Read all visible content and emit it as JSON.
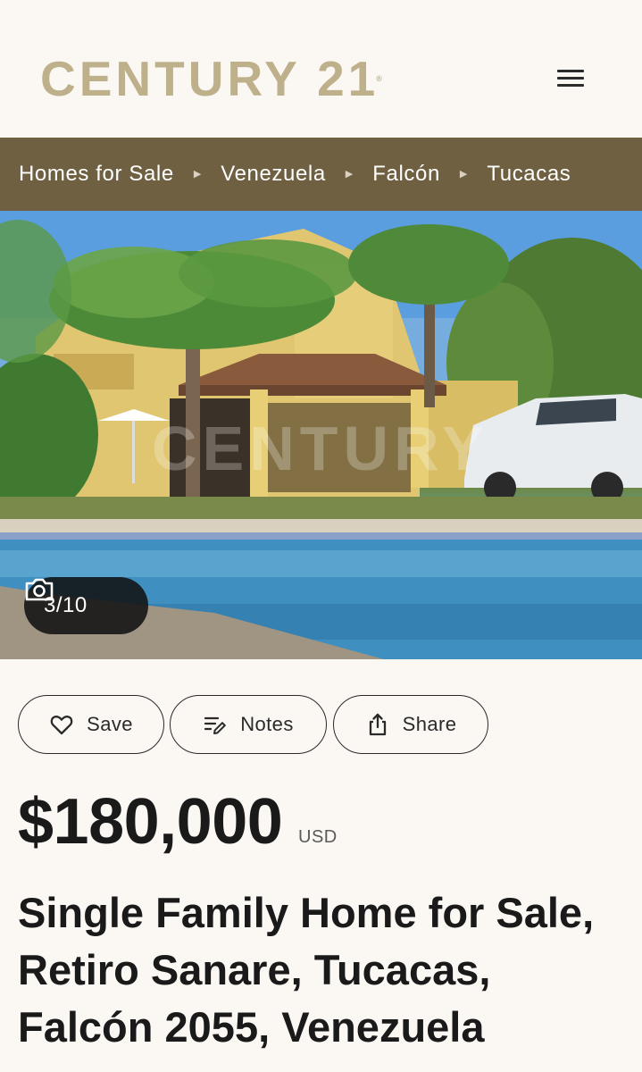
{
  "header": {
    "logo_text": "CENTURY 21",
    "logo_mark": "®",
    "menu_icon": "hamburger-menu-icon"
  },
  "breadcrumb": {
    "items": [
      "Homes for Sale",
      "Venezuela",
      "Falcón",
      "Tucacas"
    ],
    "separator_icon": "triangle-right-icon"
  },
  "gallery": {
    "counter": "3/10",
    "counter_icon": "camera-icon"
  },
  "actions": {
    "save": {
      "label": "Save",
      "icon": "heart-icon"
    },
    "notes": {
      "label": "Notes",
      "icon": "notes-edit-icon"
    },
    "share": {
      "label": "Share",
      "icon": "share-icon"
    }
  },
  "listing": {
    "price": "$180,000",
    "currency": "USD",
    "title": "Single Family Home for Sale, Retiro Sanare, Tucacas, Falcón 2055, Venezuela"
  },
  "colors": {
    "background": "#fbf7f3",
    "logo_gold": "#bdb08a",
    "breadcrumb_bar": "#6f6041",
    "text_dark": "#1a1a1a"
  }
}
